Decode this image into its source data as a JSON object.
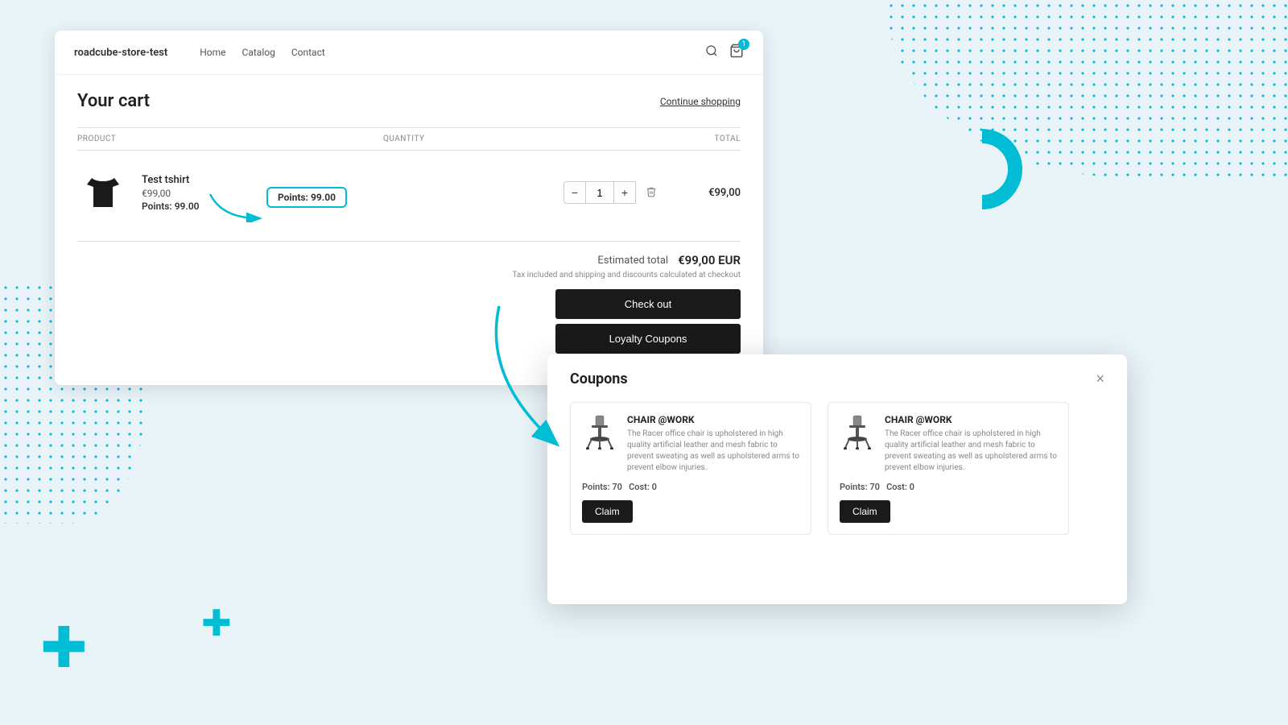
{
  "background": {
    "accent_color": "#00bcd4"
  },
  "nav": {
    "logo": "roadcube-store-test",
    "links": [
      "Home",
      "Catalog",
      "Contact"
    ],
    "cart_count": "1"
  },
  "cart": {
    "title": "Your cart",
    "continue_shopping": "Continue shopping",
    "columns": {
      "product": "PRODUCT",
      "quantity": "QUANTITY",
      "total": "TOTAL"
    },
    "items": [
      {
        "name": "Test tshirt",
        "price": "€99,00",
        "points_label": "Points:",
        "points_value": "99.00",
        "quantity": "1",
        "total": "€99,00"
      }
    ],
    "points_tooltip": {
      "label": "Points:",
      "value": "99.00"
    },
    "summary": {
      "estimated_label": "Estimated total",
      "estimated_value": "€99,00 EUR",
      "tax_note": "Tax included and shipping and discounts calculated at checkout"
    },
    "checkout_label": "Check out",
    "loyalty_label": "Loyalty Coupons"
  },
  "coupons_modal": {
    "title": "Coupons",
    "close_label": "×",
    "items": [
      {
        "name": "CHAIR @WORK",
        "description": "The Racer office chair is upholstered in high quality artificial leather and mesh fabric to prevent sweating as well as upholstered arms to prevent elbow injuries.",
        "points_label": "Points:",
        "points_value": "70",
        "cost_label": "Cost:",
        "cost_value": "0",
        "claim_label": "Claim"
      },
      {
        "name": "CHAIR @WORK",
        "description": "The Racer office chair is upholstered in high quality artificial leather and mesh fabric to prevent sweating as well as upholstered arms to prevent elbow injuries.",
        "points_label": "Points:",
        "points_value": "70",
        "cost_label": "Cost:",
        "cost_value": "0",
        "claim_label": "Claim"
      }
    ]
  }
}
